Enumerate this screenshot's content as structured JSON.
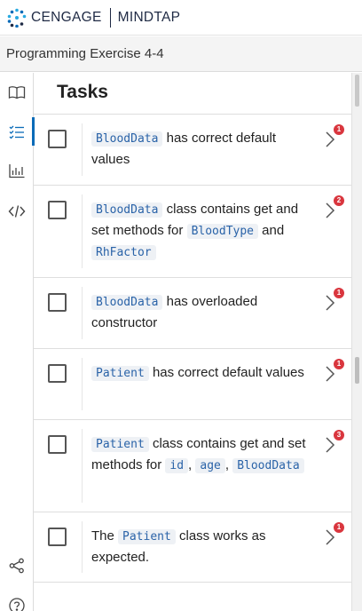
{
  "header": {
    "brand": "CENGAGE",
    "product": "MINDTAP",
    "logo_colors": [
      "#0a6bb8",
      "#28a9e0",
      "#1f2a44"
    ]
  },
  "titlebar": {
    "title": "Programming Exercise 4-4"
  },
  "rail": {
    "items": [
      {
        "icon": "book-icon"
      },
      {
        "icon": "task-list-icon",
        "active": true
      },
      {
        "icon": "bar-chart-icon"
      },
      {
        "icon": "code-icon"
      },
      {
        "icon": "share-icon"
      },
      {
        "icon": "help-icon"
      }
    ]
  },
  "panel": {
    "title": "Tasks"
  },
  "tasks": [
    {
      "parts": [
        {
          "code": "BloodData"
        },
        {
          "text": " has correct default values"
        }
      ],
      "badge": "1"
    },
    {
      "parts": [
        {
          "code": "BloodData"
        },
        {
          "text": " class contains get and set methods for "
        },
        {
          "code": "BloodType"
        },
        {
          "text": " and "
        },
        {
          "code": "RhFactor"
        }
      ],
      "badge": "2"
    },
    {
      "parts": [
        {
          "code": "BloodData"
        },
        {
          "text": " has overloaded constructor"
        }
      ],
      "badge": "1"
    },
    {
      "parts": [
        {
          "code": "Patient"
        },
        {
          "text": " has correct default values"
        }
      ],
      "badge": "1"
    },
    {
      "parts": [
        {
          "code": "Patient"
        },
        {
          "text": " class contains get and set methods for "
        },
        {
          "code": "id"
        },
        {
          "text": ", "
        },
        {
          "code": "age"
        },
        {
          "text": ", "
        },
        {
          "code": "BloodData"
        }
      ],
      "badge": "3"
    },
    {
      "parts": [
        {
          "text": "The "
        },
        {
          "code": "Patient"
        },
        {
          "text": " class works as expected."
        }
      ],
      "badge": "1"
    }
  ],
  "colors": {
    "accent": "#0a6bb8",
    "badge": "#d9363e",
    "code_text": "#2a63a8",
    "code_bg": "#eef1f5"
  }
}
